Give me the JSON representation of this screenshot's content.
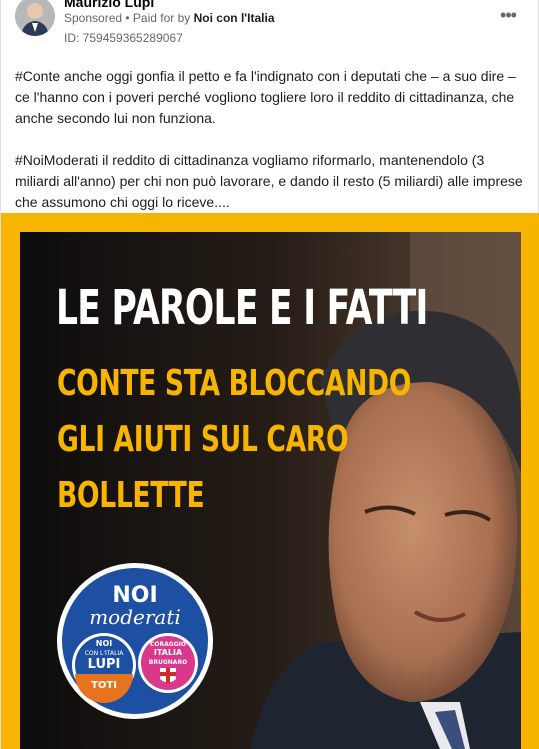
{
  "post": {
    "advertiser": "Maurizio Lupi",
    "sponsored": "Sponsored",
    "paid_for_prefix": "• Paid for by",
    "paid_for_by": "Noi con l'Italia",
    "ad_id": "ID: 759459365289067",
    "more_label": "•••",
    "paragraphs": [
      "#Conte anche oggi gonfia il petto e fa l'indignato con i deputati che – a suo dire – ce l'hanno con i poveri perché vogliono togliere loro il reddito di cittadinanza, che anche secondo lui non funziona.",
      "#NoiModerati il reddito di cittadinanza vogliamo riformarlo, mantenendolo (3 miliardi all'anno) per chi non può lavorare, e dando il resto (5 miliardi) alle imprese che assumono chi oggi lo riceve...."
    ]
  },
  "creative": {
    "headline": "LE PAROLE E I FATTI",
    "sub_lines": [
      "CONTE STA BLOCCANDO",
      "GLI AIUTI SUL CARO",
      "BOLLETTE"
    ],
    "frame_color": "#f7b500",
    "logo": {
      "title_line1": "NOI",
      "title_line2": "moderati",
      "left_top": "NOI",
      "left_mid": "CON L'ITALIA",
      "left_name": "LUPI",
      "left_bottom": "TOTI",
      "right_top": "CORAGGIO",
      "right_mid": "ITALIA",
      "right_name": "BRUGNARO"
    }
  }
}
